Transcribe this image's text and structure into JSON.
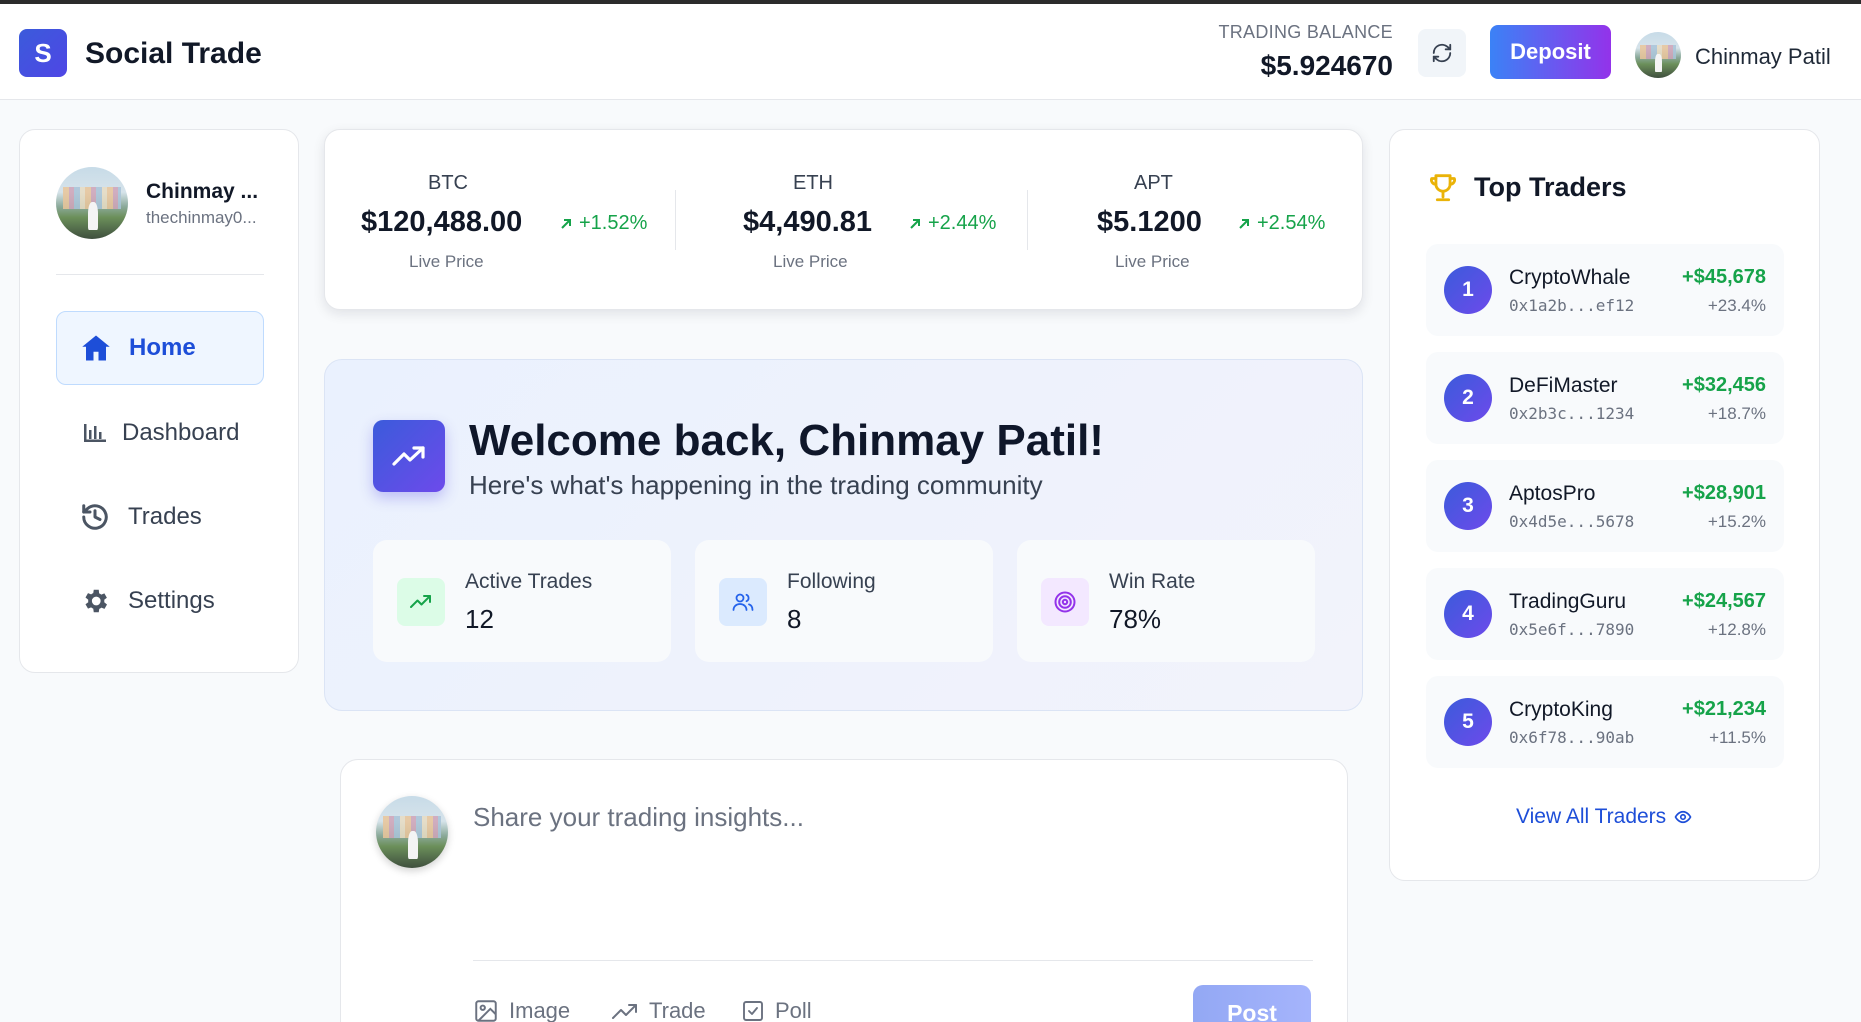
{
  "header": {
    "logo_letter": "S",
    "app_title": "Social Trade",
    "balance_label": "TRADING BALANCE",
    "balance_value": "$5.924670",
    "deposit_label": "Deposit",
    "username": "Chinmay Patil"
  },
  "sidebar": {
    "profile_name": "Chinmay ...",
    "profile_handle": "thechinmay0...",
    "items": [
      {
        "label": "Home",
        "icon": "home-icon",
        "active": true
      },
      {
        "label": "Dashboard",
        "icon": "bar-chart-icon",
        "active": false
      },
      {
        "label": "Trades",
        "icon": "history-icon",
        "active": false
      },
      {
        "label": "Settings",
        "icon": "gear-icon",
        "active": false
      }
    ]
  },
  "ticker": [
    {
      "symbol": "BTC",
      "price": "$120,488.00",
      "change": "+1.52%",
      "note": "Live Price"
    },
    {
      "symbol": "ETH",
      "price": "$4,490.81",
      "change": "+2.44%",
      "note": "Live Price"
    },
    {
      "symbol": "APT",
      "price": "$5.1200",
      "change": "+2.54%",
      "note": "Live Price"
    }
  ],
  "welcome": {
    "title": "Welcome back, Chinmay Patil!",
    "subtitle": "Here's what's happening in the trading community",
    "stats": [
      {
        "label": "Active Trades",
        "value": "12",
        "icon": "trending-up-icon",
        "color": "#16a34a",
        "bg": "#dcfce7"
      },
      {
        "label": "Following",
        "value": "8",
        "icon": "users-icon",
        "color": "#2563eb",
        "bg": "#dbeafe"
      },
      {
        "label": "Win Rate",
        "value": "78%",
        "icon": "target-icon",
        "color": "#9333ea",
        "bg": "#f3e8ff"
      }
    ]
  },
  "composer": {
    "placeholder": "Share your trading insights...",
    "actions": [
      {
        "label": "Image",
        "icon": "image-icon"
      },
      {
        "label": "Trade",
        "icon": "trending-up-icon"
      },
      {
        "label": "Poll",
        "icon": "poll-icon"
      }
    ],
    "post_label": "Post"
  },
  "top_traders": {
    "title": "Top Traders",
    "traders": [
      {
        "rank": "1",
        "name": "CryptoWhale",
        "address": "0x1a2b...ef12",
        "profit": "+$45,678",
        "pct": "+23.4%"
      },
      {
        "rank": "2",
        "name": "DeFiMaster",
        "address": "0x2b3c...1234",
        "profit": "+$32,456",
        "pct": "+18.7%"
      },
      {
        "rank": "3",
        "name": "AptosPro",
        "address": "0x4d5e...5678",
        "profit": "+$28,901",
        "pct": "+15.2%"
      },
      {
        "rank": "4",
        "name": "TradingGuru",
        "address": "0x5e6f...7890",
        "profit": "+$24,567",
        "pct": "+12.8%"
      },
      {
        "rank": "5",
        "name": "CryptoKing",
        "address": "0x6f78...90ab",
        "profit": "+$21,234",
        "pct": "+11.5%"
      }
    ],
    "view_all_label": "View All Traders"
  },
  "colors": {
    "accent": "#1d4ed8",
    "positive": "#16a34a",
    "trophy": "#eab308"
  }
}
